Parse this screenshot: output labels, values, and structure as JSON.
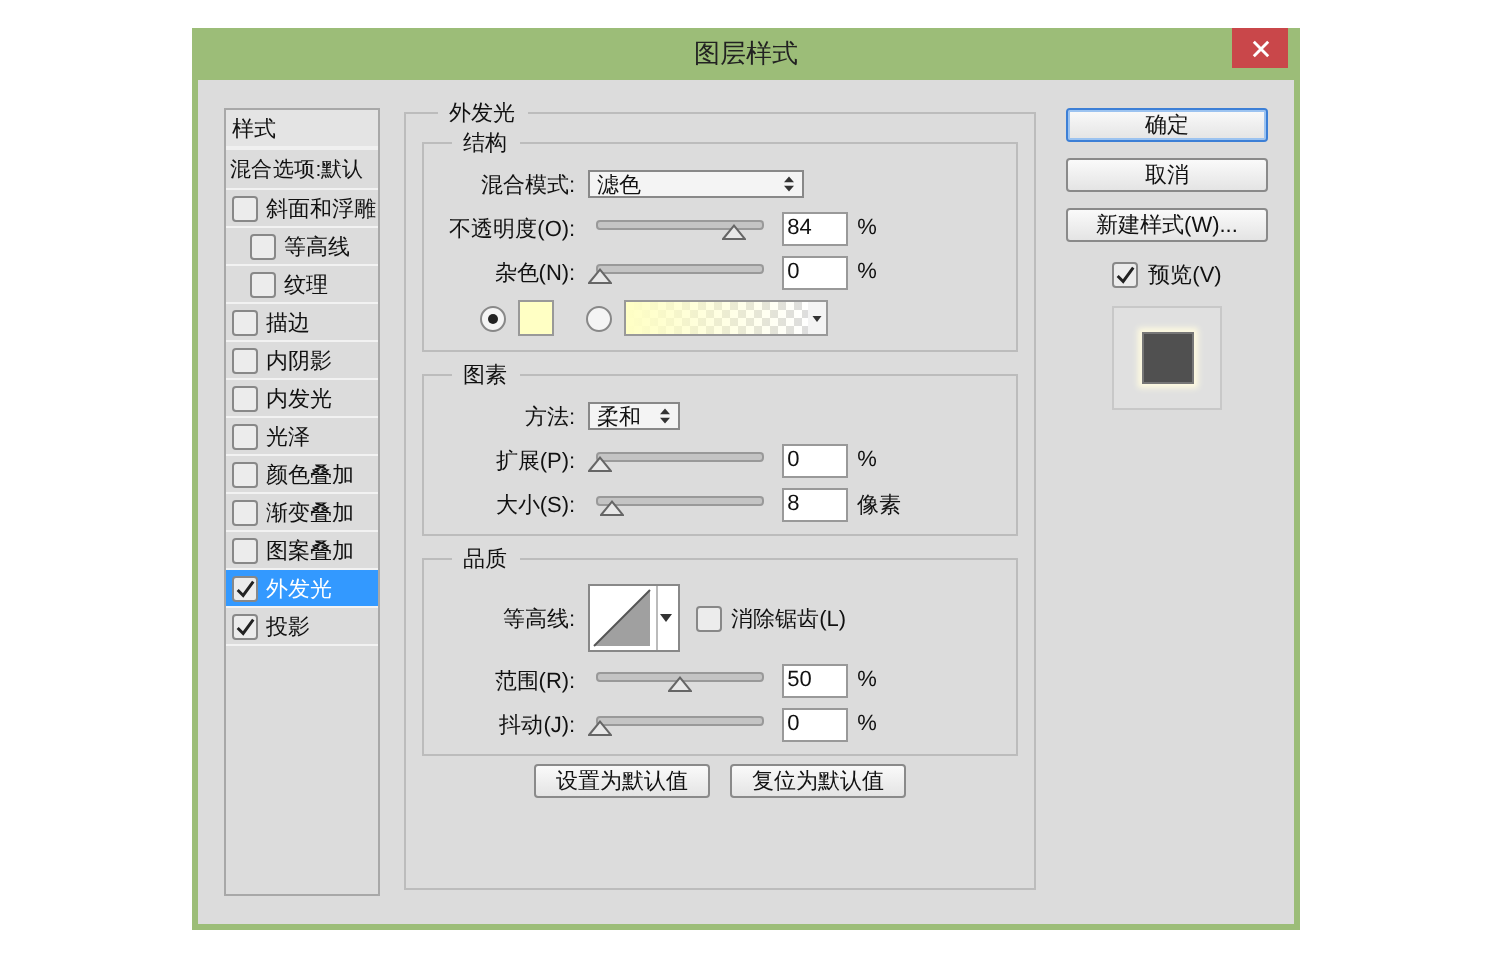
{
  "window": {
    "title": "图层样式"
  },
  "sidebar": {
    "header": "样式",
    "items": [
      {
        "kind": "plain",
        "label": "混合选项:默认",
        "selected": false
      },
      {
        "kind": "check",
        "label": "斜面和浮雕",
        "checked": false,
        "selected": false,
        "children": [
          {
            "kind": "check",
            "label": "等高线",
            "checked": false,
            "selected": false
          },
          {
            "kind": "check",
            "label": "纹理",
            "checked": false,
            "selected": false
          }
        ]
      },
      {
        "kind": "check",
        "label": "描边",
        "checked": false,
        "selected": false
      },
      {
        "kind": "check",
        "label": "内阴影",
        "checked": false,
        "selected": false
      },
      {
        "kind": "check",
        "label": "内发光",
        "checked": false,
        "selected": false
      },
      {
        "kind": "check",
        "label": "光泽",
        "checked": false,
        "selected": false
      },
      {
        "kind": "check",
        "label": "颜色叠加",
        "checked": false,
        "selected": false
      },
      {
        "kind": "check",
        "label": "渐变叠加",
        "checked": false,
        "selected": false
      },
      {
        "kind": "check",
        "label": "图案叠加",
        "checked": false,
        "selected": false
      },
      {
        "kind": "check",
        "label": "外发光",
        "checked": true,
        "selected": true
      },
      {
        "kind": "check",
        "label": "投影",
        "checked": true,
        "selected": false
      }
    ]
  },
  "panel": {
    "title": "外发光",
    "groups": [
      {
        "title": "结构",
        "controls": [
          {
            "kind": "select",
            "label": "混合模式:",
            "value": "滤色",
            "wide": true
          },
          {
            "kind": "slider",
            "label": "不透明度(O):",
            "level": 0.84,
            "value": "84",
            "unit": "%"
          },
          {
            "kind": "slider",
            "label": "杂色(N):",
            "level": 0,
            "value": "0",
            "unit": "%"
          },
          {
            "kind": "color_source",
            "options": [
              {
                "kind": "solid",
                "selected": true,
                "color": "#ffffc4"
              },
              {
                "kind": "gradient",
                "selected": false,
                "color": "#ffffc4"
              }
            ]
          }
        ]
      },
      {
        "title": "图素",
        "controls": [
          {
            "kind": "select",
            "label": "方法:",
            "value": "柔和",
            "wide": false
          },
          {
            "kind": "slider",
            "label": "扩展(P):",
            "level": 0,
            "value": "0",
            "unit": "%"
          },
          {
            "kind": "slider",
            "label": "大小(S):",
            "level": 0.08,
            "value": "8",
            "unit": "像素"
          }
        ]
      },
      {
        "title": "品质",
        "controls": [
          {
            "kind": "contour",
            "label": "等高线:",
            "antialias": {
              "label": "消除锯齿(L)",
              "checked": false
            }
          },
          {
            "kind": "slider",
            "label": "范围(R):",
            "level": 0.5,
            "value": "50",
            "unit": "%"
          },
          {
            "kind": "slider",
            "label": "抖动(J):",
            "level": 0,
            "value": "0",
            "unit": "%"
          }
        ]
      }
    ],
    "buttons": [
      "设置为默认值",
      "复位为默认值"
    ]
  },
  "actions": [
    {
      "label": "确定",
      "default": true
    },
    {
      "label": "取消",
      "default": false
    },
    {
      "label": "新建样式(W)...",
      "default": false
    }
  ],
  "preview": {
    "label": "预览(V)",
    "checked": true
  }
}
